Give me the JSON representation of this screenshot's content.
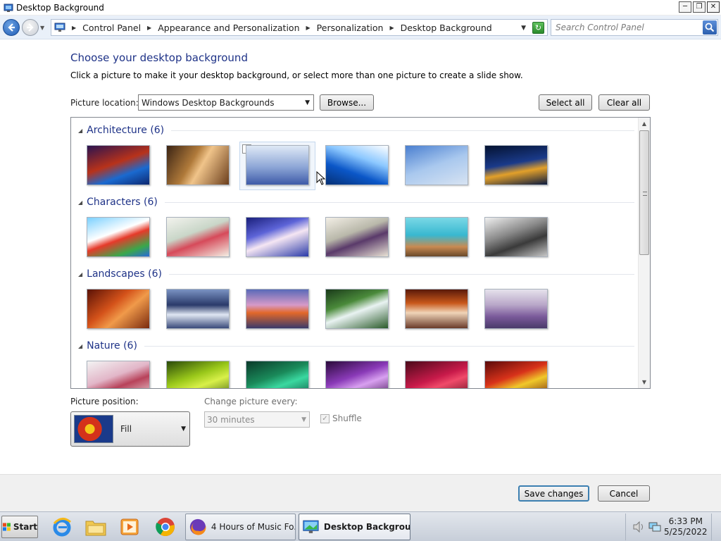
{
  "window": {
    "title": "Desktop Background"
  },
  "address": {
    "crumbs": [
      "Control Panel",
      "Appearance and Personalization",
      "Personalization",
      "Desktop Background"
    ],
    "search_placeholder": "Search Control Panel"
  },
  "page": {
    "heading": "Choose your desktop background",
    "subheading": "Click a picture to make it your desktop background, or select more than one picture to create a slide show."
  },
  "location": {
    "label": "Picture location:",
    "value": "Windows Desktop Backgrounds",
    "browse": "Browse...",
    "select_all": "Select all",
    "clear_all": "Clear all"
  },
  "groups": [
    {
      "title": "Architecture (6)",
      "thumbs": [
        "linear-gradient(160deg,#2b1350 0%,#b8321a 45%,#1a6ad0 70%,#0d2870 100%)",
        "linear-gradient(120deg,#3b2414 0%,#b07a3a 40%,#f0c48a 55%,#6b3e1c 100%)",
        "linear-gradient(180deg,#dfe9f6 0%,#8da6d6 55%,#3d5aa8 100%)",
        "linear-gradient(200deg,#ffffff 0%,#8cc8ff 35%,#0b57c8 65%,#063074 100%)",
        "linear-gradient(160deg,#4a7fd0 0%,#a9c8ee 50%,#d7e3f2 100%)",
        "linear-gradient(170deg,#041230 0%,#1a3a8a 45%,#e2a02a 65%,#0b1a3e 100%)"
      ]
    },
    {
      "title": "Characters (6)",
      "thumbs": [
        "linear-gradient(160deg,#7ad0ff 0%,#ffffff 40%,#e63a2a 55%,#3aa84a 80%,#2a6ad8 100%)",
        "linear-gradient(160deg,#f3f3ee 0%,#c9d6c8 40%,#d64a5a 60%,#f3efe4 100%)",
        "linear-gradient(160deg,#1a1f7a 0%,#5d64d8 35%,#f5e6f3 55%,#2a3aa8 100%)",
        "linear-gradient(160deg,#f3efe6 0%,#b9b8aa 40%,#5a3a6a 60%,#e9e3d5 100%)",
        "linear-gradient(180deg,#7ad8e6 0%,#38b8d0 45%,#c88a52 75%,#6a4a2a 100%)",
        "linear-gradient(160deg,#f0f0f0 0%,#8a8a8a 40%,#3a3a3a 65%,#c8c8c8 100%)"
      ]
    },
    {
      "title": "Landscapes (6)",
      "thumbs": [
        "linear-gradient(140deg,#5a1206 0%,#d4521a 40%,#f09a4a 60%,#7a2a0e 100%)",
        "linear-gradient(180deg,#7a92c2 0%,#2a3a6a 40%,#dfe6f2 65%,#3a4a7a 100%)",
        "linear-gradient(180deg,#5a6ab8 0%,#d69ac8 40%,#e2682a 60%,#3a3a6a 100%)",
        "linear-gradient(160deg,#1a3a1a 0%,#4a8a3a 35%,#e9f3f2 55%,#2a5a2a 100%)",
        "linear-gradient(180deg,#5a1a0a 0%,#c8581a 35%,#f0d4b8 60%,#6a3a2a 100%)",
        "linear-gradient(180deg,#e6e2ec 0%,#b8a6c8 40%,#7a5a9a 70%,#4a3a6a 100%)"
      ]
    },
    {
      "title": "Nature (6)",
      "thumbs": [
        "linear-gradient(160deg,#f3f3f3 0%,#e2b6c8 40%,#b8425a 60%,#f0e8ea 100%)",
        "linear-gradient(160deg,#2a4a0a 0%,#9ac81a 40%,#d8f04a 60%,#3a5a0e 100%)",
        "linear-gradient(160deg,#0a3a2a 0%,#1a8a5a 40%,#3ad8a0 60%,#0a4a3a 100%)",
        "linear-gradient(160deg,#2a0a3a 0%,#8a3ab8 40%,#d8a0f0 60%,#3a0a4a 100%)",
        "linear-gradient(160deg,#4a0a1a 0%,#c81a4a 45%,#f04a6a 60%,#5a0a1a 100%)",
        "linear-gradient(160deg,#5a0a0a 0%,#d8321a 40%,#f0c82a 60%,#6a1a0a 100%)"
      ]
    }
  ],
  "position": {
    "label": "Picture position:",
    "value": "Fill"
  },
  "interval": {
    "label": "Change picture every:",
    "value": "30 minutes"
  },
  "shuffle": {
    "label": "Shuffle",
    "checked": true
  },
  "footer": {
    "save": "Save changes",
    "cancel": "Cancel"
  },
  "taskbar": {
    "start": "Start",
    "tasks": [
      "4 Hours of Music Fo...",
      "Desktop Backgrou..."
    ],
    "time": "6:33 PM",
    "date": "5/25/2022"
  },
  "colors": {
    "accent_heading": "#1e3287",
    "selection_border": "#c5d8ee",
    "primary_button_border": "#3c7fb1"
  }
}
